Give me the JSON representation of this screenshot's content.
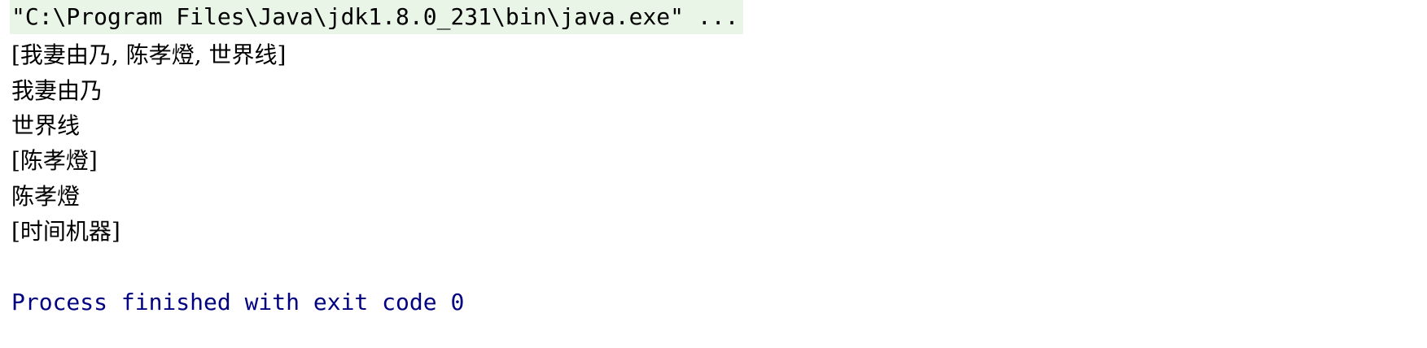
{
  "console": {
    "command": "\"C:\\Program Files\\Java\\jdk1.8.0_231\\bin\\java.exe\" ...",
    "output_lines": [
      "[我妻由乃, 陈孝燈, 世界线]",
      "我妻由乃",
      "世界线",
      "[陈孝燈]",
      "陈孝燈",
      "[时间机器]"
    ],
    "process_status": "Process finished with exit code 0"
  },
  "colors": {
    "command_highlight": "#e9f5e6",
    "status_text": "#000080"
  }
}
